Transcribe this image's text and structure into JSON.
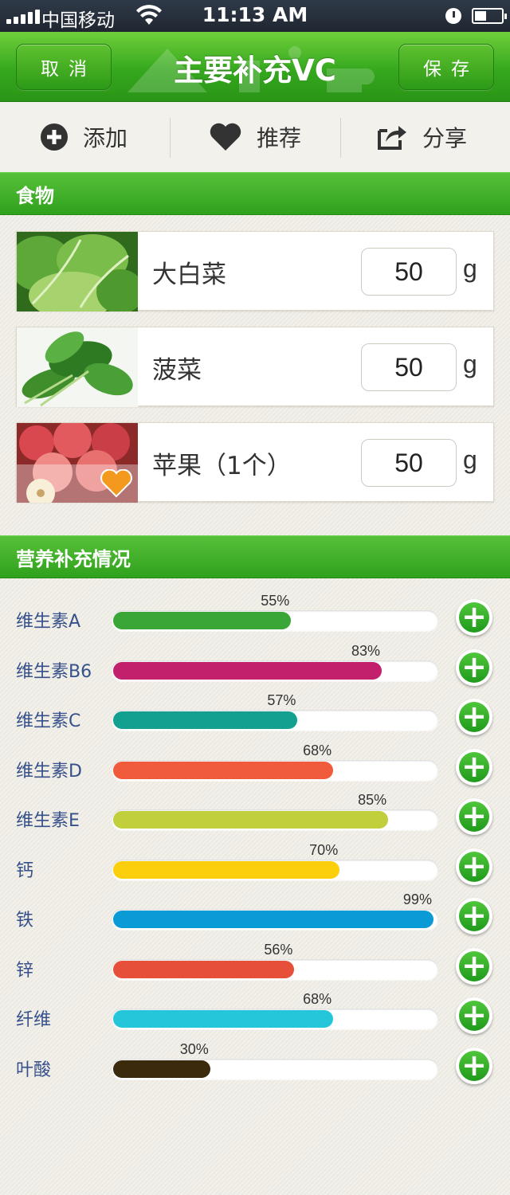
{
  "status_bar": {
    "carrier": "中国移动",
    "time": "11:13 AM"
  },
  "header": {
    "title": "主要补充VC",
    "cancel_label": "取消",
    "save_label": "保存"
  },
  "toolbar": {
    "add_label": "添加",
    "recommend_label": "推荐",
    "share_label": "分享"
  },
  "foods_section": {
    "title": "食物",
    "items": [
      {
        "name": "大白菜",
        "quantity": "50",
        "unit": "g",
        "image": "cabbage-photo"
      },
      {
        "name": "菠菜",
        "quantity": "50",
        "unit": "g",
        "image": "spinach-photo"
      },
      {
        "name": "苹果（1个）",
        "quantity": "50",
        "unit": "g",
        "image": "apple-photo",
        "favorited": true
      }
    ]
  },
  "nutrition_section": {
    "title": "营养补充情况",
    "items": [
      {
        "name": "维生素A",
        "percent": 55,
        "percent_label": "55%",
        "color": "#3aa637"
      },
      {
        "name": "维生素B6",
        "percent": 83,
        "percent_label": "83%",
        "color": "#c2206d"
      },
      {
        "name": "维生素C",
        "percent": 57,
        "percent_label": "57%",
        "color": "#13a091"
      },
      {
        "name": "维生素D",
        "percent": 68,
        "percent_label": "68%",
        "color": "#ef5b3b"
      },
      {
        "name": "维生素E",
        "percent": 85,
        "percent_label": "85%",
        "color": "#c1cf3c"
      },
      {
        "name": "钙",
        "percent": 70,
        "percent_label": "70%",
        "color": "#fccf0c"
      },
      {
        "name": "铁",
        "percent": 99,
        "percent_label": "99%",
        "color": "#0a9bd6"
      },
      {
        "name": "锌",
        "percent": 56,
        "percent_label": "56%",
        "color": "#e6503a"
      },
      {
        "name": "纤维",
        "percent": 68,
        "percent_label": "68%",
        "color": "#26c6da"
      },
      {
        "name": "叶酸",
        "percent": 30,
        "percent_label": "30%",
        "color": "#3b2a0c"
      }
    ]
  }
}
